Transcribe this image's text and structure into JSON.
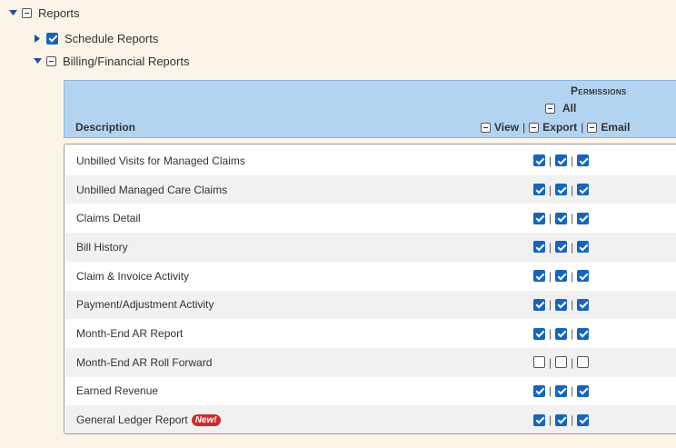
{
  "tree": {
    "reports": {
      "label": "Reports"
    },
    "schedule_reports": {
      "label": "Schedule Reports"
    },
    "billing_reports": {
      "label": "Billing/Financial Reports"
    }
  },
  "permissions_header": {
    "title": "Permissions",
    "all_label": "All",
    "description_label": "Description",
    "view_label": "View",
    "export_label": "Export",
    "email_label": "Email"
  },
  "rows": [
    {
      "description": "Unbilled Visits for Managed Claims",
      "view": true,
      "export": true,
      "email": true
    },
    {
      "description": "Unbilled Managed Care Claims",
      "view": true,
      "export": true,
      "email": true
    },
    {
      "description": "Claims Detail",
      "view": true,
      "export": true,
      "email": true
    },
    {
      "description": "Bill History",
      "view": true,
      "export": true,
      "email": true
    },
    {
      "description": "Claim & Invoice Activity",
      "view": true,
      "export": true,
      "email": true
    },
    {
      "description": "Payment/Adjustment Activity",
      "view": true,
      "export": true,
      "email": true
    },
    {
      "description": "Month-End AR Report",
      "view": true,
      "export": true,
      "email": true
    },
    {
      "description": "Month-End AR Roll Forward",
      "view": false,
      "export": false,
      "email": false
    },
    {
      "description": "Earned Revenue",
      "view": true,
      "export": true,
      "email": true
    },
    {
      "description": "General Ledger Report",
      "view": true,
      "export": true,
      "email": true,
      "badge": "New!"
    }
  ],
  "colors": {
    "checkbox_checked": "#1565c0",
    "header_bg": "#b3d4f1",
    "badge_bg": "#cc2b2b",
    "page_bg": "#fdf4e8"
  }
}
